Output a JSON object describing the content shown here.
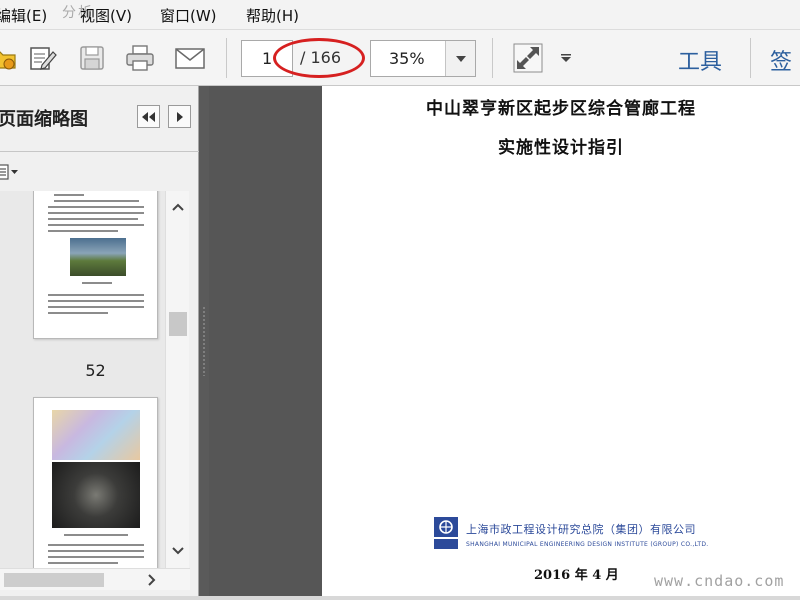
{
  "menu": {
    "edit": "编辑(E)",
    "view": "视图(V)",
    "window": "窗口(W)",
    "help": "帮助(H)"
  },
  "watermark_top": "分析",
  "toolbar": {
    "page_number": "1",
    "page_total": "/ 166",
    "zoom": "35%",
    "tools_label": "工具",
    "sign_label": "签"
  },
  "icons": {
    "open": "folder-open-icon",
    "edit": "edit-document-icon",
    "save": "save-icon",
    "print": "printer-icon",
    "email": "envelope-icon",
    "zoom_dropdown": "chevron-down-icon",
    "fullscreen": "expand-arrows-icon",
    "more": "dropdown-triangle-icon"
  },
  "sidebar": {
    "title": "页面缩略图",
    "thumbnails": [
      {
        "label": "52"
      },
      {
        "label": ""
      }
    ]
  },
  "document": {
    "title": "中山翠亨新区起步区综合管廊工程",
    "subtitle": "实施性设计指引",
    "company_cn": "上海市政工程设计研究总院（集团）有限公司",
    "company_en": "SHANGHAI MUNICIPAL ENGINEERING DESIGN INSTITUTE (GROUP) CO.,LTD.",
    "date": "2016 年 4 月"
  },
  "watermark_bottom": "www.cndao.com",
  "colors": {
    "accent_blue": "#2c5f9e",
    "highlight_red": "#d62020",
    "document_background": "#565656",
    "company_blue": "#2c4a9a"
  }
}
